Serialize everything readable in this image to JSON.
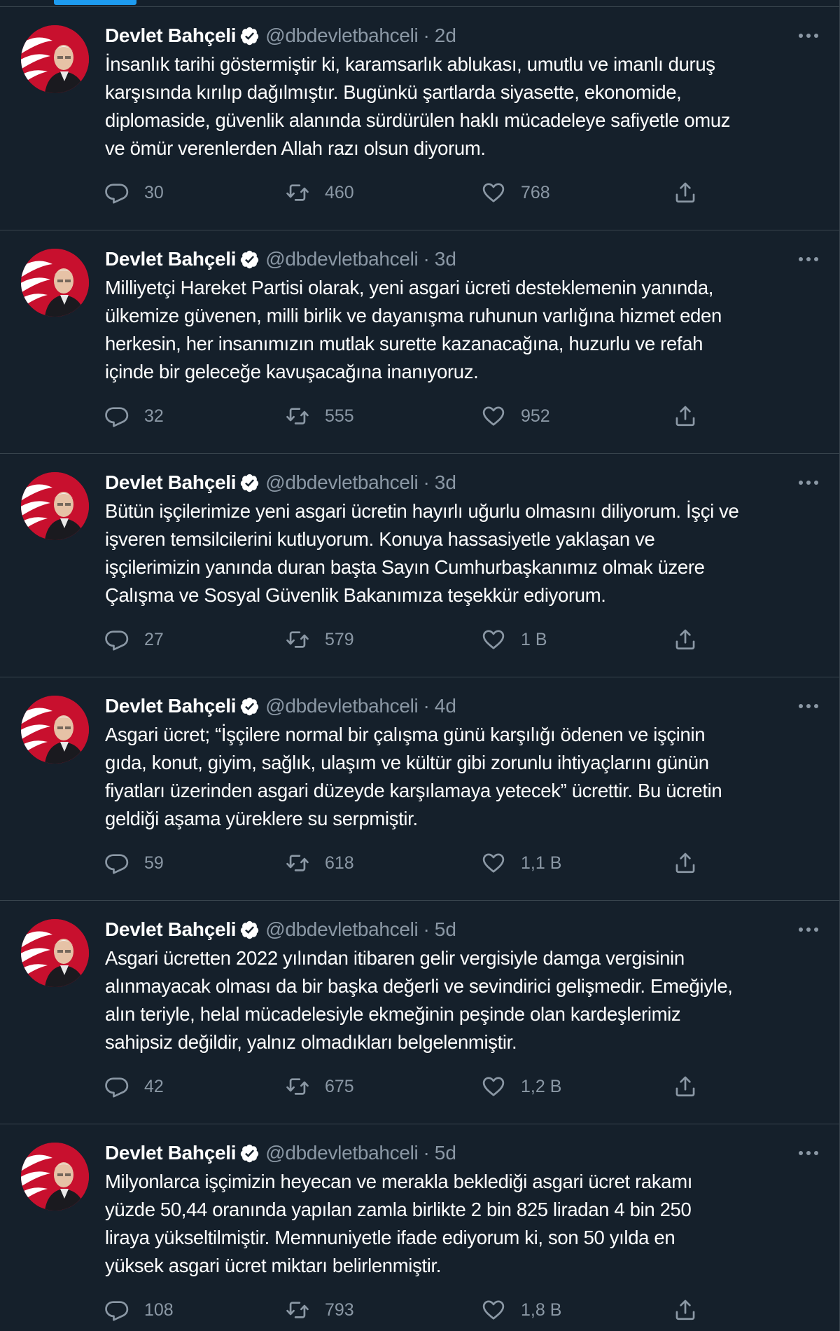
{
  "feed": {
    "author": {
      "display_name": "Devlet Bahçeli",
      "handle": "@dbdevletbahceli",
      "separator": "·"
    },
    "colors": {
      "background": "#15202b",
      "border": "#38444d",
      "text": "#ffffff",
      "muted": "#8b98a5",
      "accent": "#1d9bf0",
      "avatar_red": "#c8102e"
    },
    "icons": [
      "verified-badge-icon",
      "more-options-icon",
      "reply-icon",
      "retweet-icon",
      "like-icon",
      "share-icon"
    ],
    "tweets": [
      {
        "time": "2d",
        "lines": [
          "İnsanlık tarihi göstermiştir ki, karamsarlık ablukası, umutlu ve imanlı duruş",
          "karşısında kırılıp dağılmıştır. Bugünkü şartlarda siyasette, ekonomide,",
          "diplomaside, güvenlik alanında sürdürülen haklı mücadeleye safiyetle omuz",
          "ve ömür verenlerden Allah razı olsun diyorum."
        ],
        "replies": "30",
        "retweets": "460",
        "likes": "768"
      },
      {
        "time": "3d",
        "lines": [
          "Milliyetçi Hareket Partisi olarak, yeni asgari ücreti desteklemenin yanında,",
          "ülkemize güvenen, milli birlik ve dayanışma ruhunun varlığına hizmet eden",
          "herkesin, her insanımızın mutlak surette kazanacağına, huzurlu ve refah",
          "içinde bir geleceğe kavuşacağına inanıyoruz."
        ],
        "replies": "32",
        "retweets": "555",
        "likes": "952"
      },
      {
        "time": "3d",
        "lines": [
          "Bütün işçilerimize yeni asgari ücretin hayırlı uğurlu olmasını diliyorum. İşçi ve",
          "işveren temsilcilerini kutluyorum. Konuya hassasiyetle yaklaşan ve",
          "işçilerimizin yanında duran başta Sayın Cumhurbaşkanımız olmak üzere",
          "Çalışma ve Sosyal Güvenlik Bakanımıza teşekkür ediyorum."
        ],
        "replies": "27",
        "retweets": "579",
        "likes": "1 B"
      },
      {
        "time": "4d",
        "lines": [
          "Asgari ücret; “İşçilere normal bir çalışma günü karşılığı ödenen ve işçinin",
          "gıda, konut, giyim, sağlık, ulaşım ve kültür gibi zorunlu ihtiyaçlarını günün",
          "fiyatları üzerinden asgari düzeyde karşılamaya yetecek” ücrettir. Bu ücretin",
          "geldiği aşama yüreklere su serpmiştir."
        ],
        "replies": "59",
        "retweets": "618",
        "likes": "1,1 B"
      },
      {
        "time": "5d",
        "lines": [
          "Asgari ücretten 2022 yılından itibaren gelir vergisiyle damga vergisinin",
          "alınmayacak olması da bir başka değerli ve sevindirici gelişmedir. Emeğiyle,",
          "alın teriyle, helal mücadelesiyle ekmeğinin peşinde olan kardeşlerimiz",
          "sahipsiz değildir, yalnız olmadıkları belgelenmiştir."
        ],
        "replies": "42",
        "retweets": "675",
        "likes": "1,2 B"
      },
      {
        "time": "5d",
        "lines": [
          "Milyonlarca işçimizin heyecan ve merakla beklediği asgari ücret rakamı",
          "yüzde 50,44 oranında yapılan zamla birlikte 2 bin 825 liradan 4 bin 250",
          "liraya yükseltilmiştir. Memnuniyetle ifade ediyorum ki, son 50 yılda en",
          "yüksek asgari ücret miktarı belirlenmiştir."
        ],
        "replies": "108",
        "retweets": "793",
        "likes": "1,8 B"
      }
    ]
  }
}
